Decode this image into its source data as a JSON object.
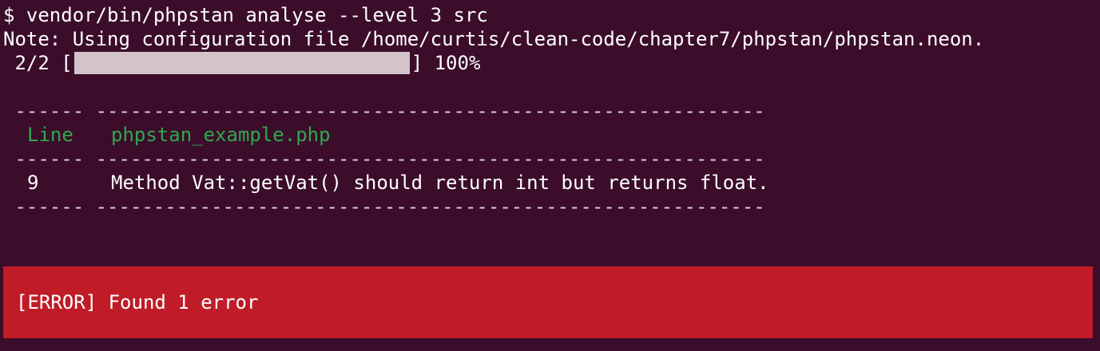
{
  "terminal": {
    "command": "$ vendor/bin/phpstan analyse --level 3 src",
    "note": "Note: Using configuration file /home/curtis/clean-code/chapter7/phpstan/phpstan.neon.",
    "progress": {
      "count": " 2/2 [",
      "close": "]",
      "percent": " 100%",
      "fraction": 1.0
    },
    "table": {
      "separator": " ------ ----------------------------------------------------------",
      "header_line": "Line",
      "header_file": "phpstan_example.php",
      "rows": [
        {
          "line": "9",
          "message": "Method Vat::getVat() should return int but returns float."
        }
      ]
    },
    "error_banner": "[ERROR] Found 1 error"
  },
  "colors": {
    "background": "#3b0d2b",
    "text": "#ffffff",
    "header": "#2fa84f",
    "error_background": "#c01c28",
    "progress_fill": "#d3c3ca"
  }
}
